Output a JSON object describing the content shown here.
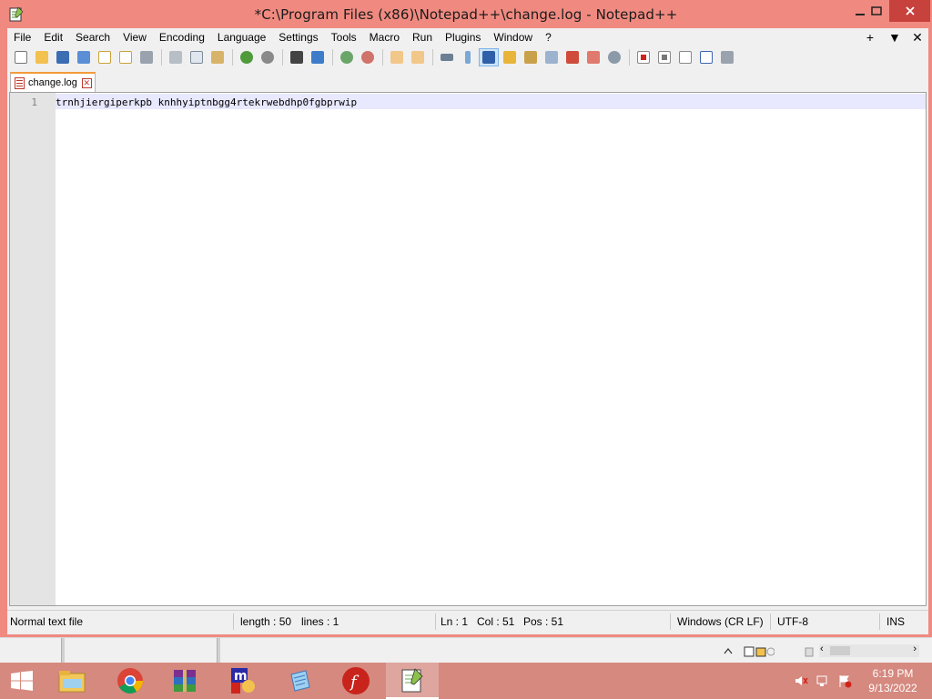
{
  "window": {
    "title": "*C:\\Program Files (x86)\\Notepad++\\change.log - Notepad++"
  },
  "menu": {
    "items": [
      "File",
      "Edit",
      "Search",
      "View",
      "Encoding",
      "Language",
      "Settings",
      "Tools",
      "Macro",
      "Run",
      "Plugins",
      "Window",
      "?"
    ],
    "right_plus": "+",
    "right_arrow": "▼",
    "right_close": "✕"
  },
  "tab": {
    "label": "change.log",
    "close": "✕"
  },
  "editor": {
    "line_number": "1",
    "text": "trnhjiergiperkpb knhhyiptnbgg4rtekrwebdhp0fgbprwip"
  },
  "status": {
    "file_type": "Normal text file",
    "length": "length : 50",
    "lines": "lines : 1",
    "ln": "Ln : 1",
    "col": "Col : 51",
    "pos": "Pos : 51",
    "eol": "Windows (CR LF)",
    "encoding": "UTF-8",
    "mode": "INS"
  },
  "taskbar": {
    "time": "6:19 PM",
    "date": "9/13/2022"
  },
  "colors": {
    "accent": "#f08a80",
    "close_button": "#c7413d",
    "tab_top": "#f29b3a",
    "current_line": "#e8e8ff"
  },
  "toolbar_icons": [
    "new-file-icon",
    "open-file-icon",
    "save-icon",
    "save-all-icon",
    "close-icon",
    "close-all-icon",
    "print-icon",
    "cut-icon",
    "copy-icon",
    "paste-icon",
    "undo-icon",
    "redo-icon",
    "find-icon",
    "replace-icon",
    "zoom-in-icon",
    "zoom-out-icon",
    "sync-vertical-icon",
    "sync-horizontal-icon",
    "word-wrap-icon",
    "show-all-characters-icon",
    "indent-guide-icon",
    "user-defined-language-icon",
    "document-map-icon",
    "function-list-icon",
    "folder-as-workspace-icon",
    "monitoring-icon",
    "record-macro-icon",
    "stop-macro-icon",
    "play-macro-icon",
    "run-macro-multiple-icon",
    "save-macro-icon"
  ]
}
